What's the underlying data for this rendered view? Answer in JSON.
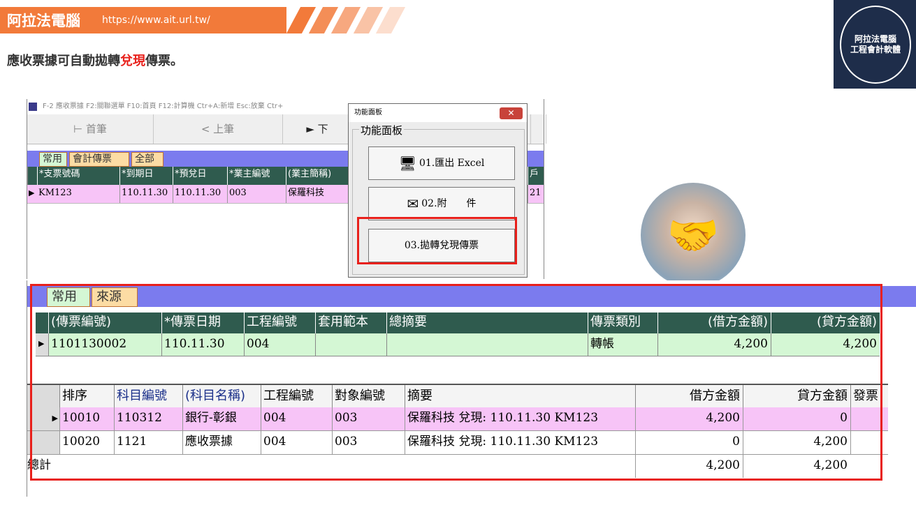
{
  "banner": {
    "brand": "阿拉法電腦",
    "url": "https://www.ait.url.tw/"
  },
  "headline": {
    "part1": "應收票據可自動拋轉",
    "highlight": "兌現",
    "part2": "傳票。"
  },
  "logo": {
    "line1": "阿拉法電腦",
    "line2": "工程會計軟體"
  },
  "upper_window": {
    "title": "F-2 應收票據   F2:關聯選單  F10:首頁   F12:計算機  Ctr+A:新增  Esc:放棄  Ctr+",
    "nav": {
      "first": "⊢ 首筆",
      "prev": "< 上筆",
      "next": "► 下"
    },
    "tabs": [
      "常用",
      "會計傳票",
      "全部"
    ],
    "columns": [
      "*支票號碼",
      "*到期日",
      "*預兌日",
      "*業主編號",
      "(業主簡稱)",
      "戶"
    ],
    "row": {
      "check_no": "KM123",
      "due": "110.11.30",
      "pre_cash": "110.11.30",
      "owner_no": "003",
      "owner_name": "保羅科技",
      "tail": "21"
    }
  },
  "function_panel": {
    "title": "功能面板",
    "close_label": "✕",
    "group_label": "功能面板",
    "buttons": [
      {
        "label": "01.匯出 Excel",
        "icon": "excel-export-icon"
      },
      {
        "label": "02.附　　件",
        "icon": "attachment-icon"
      },
      {
        "label": "03.拋轉兌現傳票"
      }
    ]
  },
  "voucher": {
    "tabs": [
      "常用",
      "來源"
    ],
    "columns": [
      "(傳票編號)",
      "*傳票日期",
      "工程編號",
      "套用範本",
      "總摘要",
      "傳票類別",
      "(借方金額)",
      "(貸方金額)"
    ],
    "row": {
      "voucher_no": "1101130002",
      "date": "110.11.30",
      "project": "004",
      "template": "",
      "summary": "",
      "type": "轉帳",
      "debit": "4,200",
      "credit": "4,200"
    }
  },
  "details": {
    "columns": [
      "排序",
      "科目編號",
      "(科目名稱)",
      "工程編號",
      "對象編號",
      "摘要",
      "借方金額",
      "貸方金額",
      "發票"
    ],
    "rows": [
      {
        "seq": "10010",
        "acct_no": "110312",
        "acct_name": "銀行-彰銀",
        "project": "004",
        "target": "003",
        "memo": "保羅科技 兌現: 110.11.30 KM123",
        "debit": "4,200",
        "credit": "0"
      },
      {
        "seq": "10020",
        "acct_no": "1121",
        "acct_name": "應收票據",
        "project": "004",
        "target": "003",
        "memo": "保羅科技 兌現: 110.11.30 KM123",
        "debit": "0",
        "credit": "4,200"
      }
    ],
    "total": {
      "label": "總計",
      "debit": "4,200",
      "credit": "4,200"
    }
  },
  "colors": {
    "accent": "#f27a3a",
    "highlight_red": "#e8201b",
    "header_green": "#2f5b4e",
    "tab_strip": "#7b7bee"
  }
}
